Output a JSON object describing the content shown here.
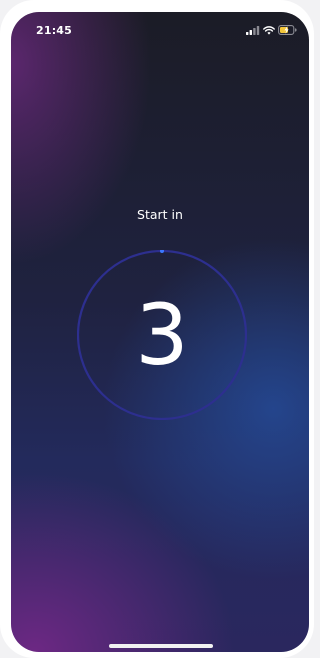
{
  "status_bar": {
    "time": "21:45",
    "icons": [
      "signal-icon",
      "wifi-icon",
      "battery-charging-icon"
    ]
  },
  "countdown": {
    "label": "Start in",
    "value": "3",
    "progress": 0
  },
  "colors": {
    "ring": "#2d2f8f",
    "progress_dot": "#3b78ff",
    "text": "#ffffff",
    "battery_charge": "#f3c63a"
  }
}
